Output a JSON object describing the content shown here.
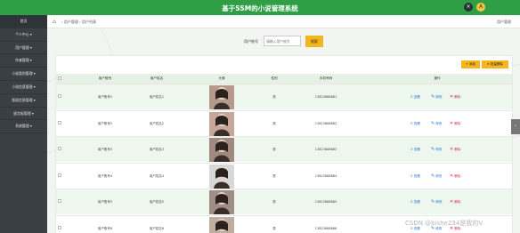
{
  "header": {
    "title": "基于SSM的小说管理系统",
    "close_icon": "×",
    "user_icon": "A"
  },
  "sidebar": {
    "items": [
      {
        "label": "首页"
      },
      {
        "label": "个人中心 ▾"
      },
      {
        "label": "用户管理 ▾"
      },
      {
        "label": "作者管理 ▾"
      },
      {
        "label": "小说类别管理 ▾"
      },
      {
        "label": "小说信息管理 ▾"
      },
      {
        "label": "版权信息管理 ▾"
      },
      {
        "label": "留言板管理 ▾"
      },
      {
        "label": "系统管理 ▾"
      }
    ]
  },
  "breadcrumb": {
    "home_icon": "⌂",
    "path": "› 用户管理 › 用户列表",
    "right": "用户管理"
  },
  "search": {
    "label": "用户账号",
    "placeholder": "请输入用户账号",
    "button": "搜索"
  },
  "toolbar": {
    "add": "+ 添加",
    "batch_delete": "✕ 批量删除"
  },
  "table": {
    "headers": [
      "用户账号",
      "用户姓名",
      "头像",
      "性别",
      "手机号码",
      "操作"
    ],
    "actions": {
      "view": "查看",
      "edit": "修改",
      "delete": "删除"
    },
    "rows": [
      {
        "account": "用户账号1",
        "name": "用户姓名1",
        "gender": "男",
        "phone": "13823888881"
      },
      {
        "account": "用户账号2",
        "name": "用户姓名2",
        "gender": "男",
        "phone": "13823888882"
      },
      {
        "account": "用户账号3",
        "name": "用户姓名3",
        "gender": "男",
        "phone": "13823888883"
      },
      {
        "account": "用户账号4",
        "name": "用户姓名4",
        "gender": "男",
        "phone": "13823888884"
      },
      {
        "account": "用户账号5",
        "name": "用户姓名5",
        "gender": "男",
        "phone": "13823888885"
      },
      {
        "account": "用户账号6",
        "name": "用户姓名6",
        "gender": "男",
        "phone": "13823888886"
      }
    ]
  },
  "watermark": "CSDN @bishe234是我的V",
  "colors": {
    "header": "#2f9e44",
    "sidebar": "#3a3f44",
    "accent": "#f5b51e",
    "row_highlight": "#edf7ed"
  }
}
